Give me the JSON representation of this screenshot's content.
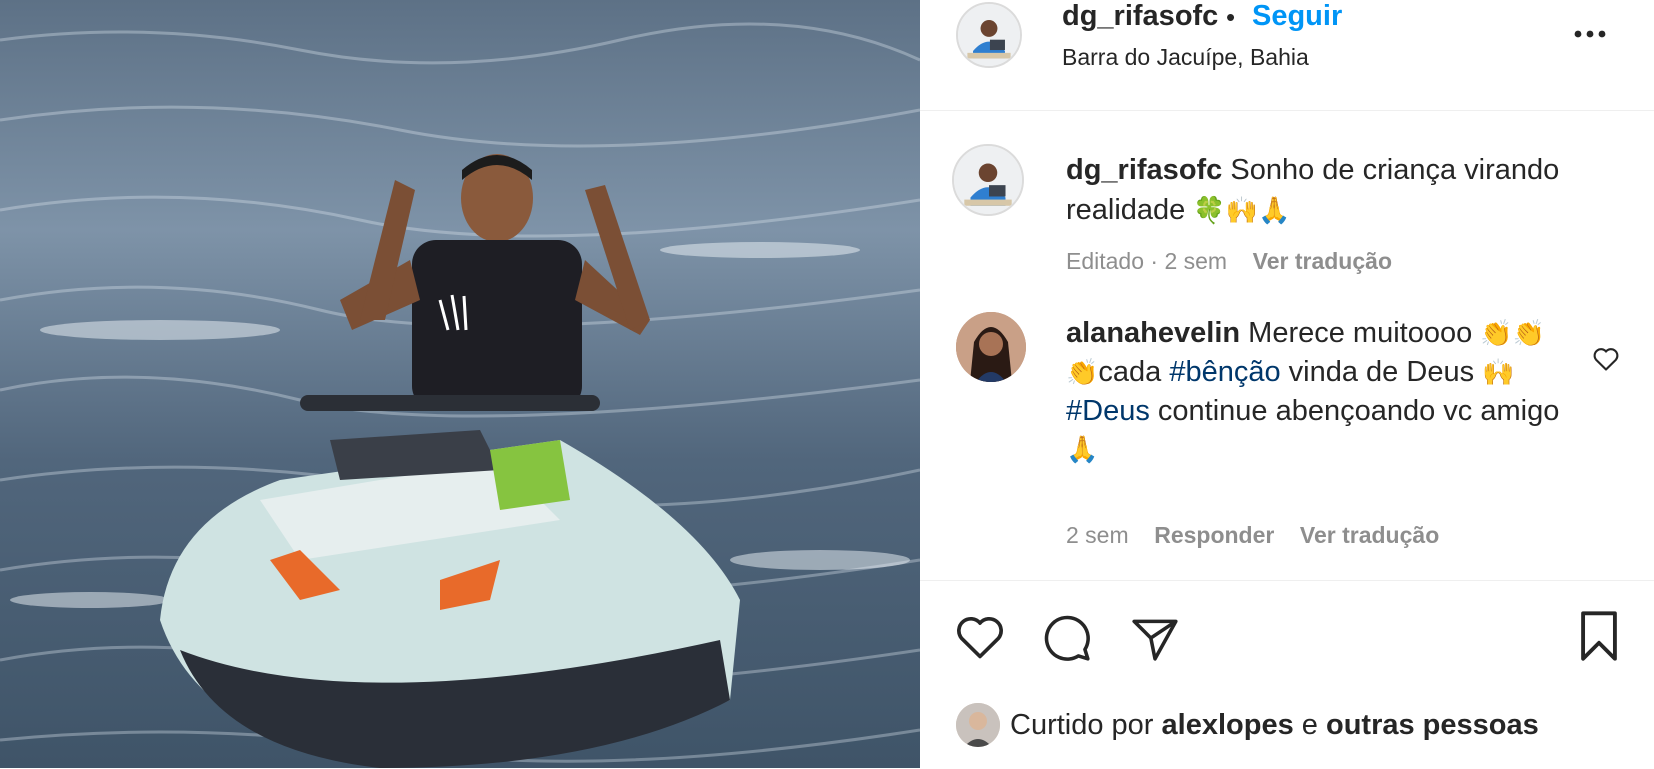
{
  "post": {
    "username": "dg_rifasofc",
    "separator": "•",
    "follow_label": "Seguir",
    "location": "Barra do Jacuípe, Bahia",
    "more_icon": "more-horizontal-icon",
    "image_alt": "Homem sorrindo em um jet ski Sea-Doo na água"
  },
  "caption": {
    "username": "dg_rifasofc",
    "text": "Sonho de criança virando realidade",
    "emojis": "🍀🙌🙏",
    "edited": "Editado · 2 sem",
    "translate": "Ver tradução"
  },
  "comment": {
    "username": "alanahevelin",
    "text1": "Merece muitoooo",
    "emojis1": "👏👏👏",
    "text2": "cada",
    "tag1": "#bênção",
    "text3": "vinda de Deus",
    "emojis2": "🙌",
    "tag2": "#Deus",
    "text4": "continue abençoando vc amigo",
    "emojis3": "🙏",
    "time": "2 sem",
    "reply": "Responder",
    "translate": "Ver tradução",
    "like_icon": "heart-outline-icon"
  },
  "likes": {
    "prefix": "Curtido por",
    "user": "alexlopes",
    "conj": "e",
    "others": "outras pessoas"
  },
  "colors": {
    "link_blue": "#0095f6",
    "hashtag": "#00376b",
    "muted": "#8e8e8e",
    "text": "#262626"
  }
}
